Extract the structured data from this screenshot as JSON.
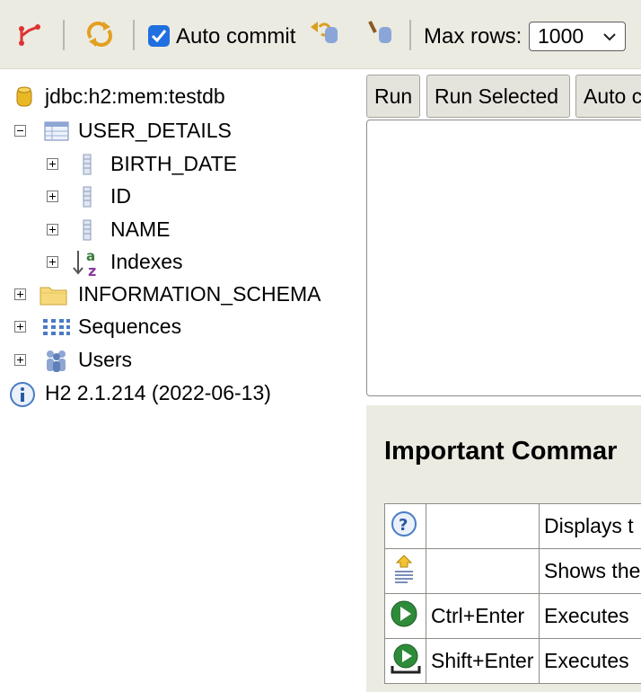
{
  "toolbar": {
    "auto_commit_label": "Auto commit",
    "auto_commit_checked": true,
    "max_rows_label": "Max rows:",
    "max_rows_value": "1000"
  },
  "tree": {
    "connection": "jdbc:h2:mem:testdb",
    "table": "USER_DETAILS",
    "columns": [
      "BIRTH_DATE",
      "ID",
      "NAME"
    ],
    "indexes": "Indexes",
    "schema": "INFORMATION_SCHEMA",
    "sequences": "Sequences",
    "users": "Users",
    "version": "H2 2.1.214 (2022-06-13)"
  },
  "query": {
    "run_label": "Run",
    "run_selected_label": "Run Selected",
    "auto_complete_label": "Auto c"
  },
  "help": {
    "title": "Important Commar",
    "rows": [
      {
        "icon": "help-icon",
        "keys": "",
        "desc": "Displays t"
      },
      {
        "icon": "history-icon",
        "keys": "",
        "desc": "Shows the"
      },
      {
        "icon": "run-icon",
        "keys": "Ctrl+Enter",
        "desc": "Executes"
      },
      {
        "icon": "run-selected-icon",
        "keys": "Shift+Enter",
        "desc": "Executes"
      }
    ]
  },
  "colors": {
    "toolbar_bg": "#ecebe2",
    "checkbox_accent": "#1f6fe0",
    "db_yellow": "#e8b925"
  }
}
